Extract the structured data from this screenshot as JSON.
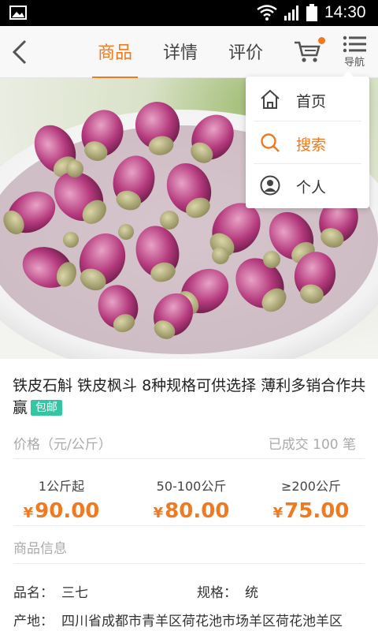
{
  "status_bar": {
    "time": "14:30"
  },
  "header": {
    "tabs": [
      {
        "label": "商品",
        "active": true
      },
      {
        "label": "详情",
        "active": false
      },
      {
        "label": "评价",
        "active": false
      }
    ],
    "nav_label": "导航"
  },
  "dropdown": {
    "items": [
      {
        "label": "首页",
        "icon": "home-icon",
        "active": false
      },
      {
        "label": "搜索",
        "icon": "search-icon",
        "active": true
      },
      {
        "label": "个人",
        "icon": "user-icon",
        "active": false
      }
    ]
  },
  "product": {
    "title": "铁皮石斛 铁皮枫斗 8种规格可供选择 薄利多销合作共赢",
    "badge": "包邮",
    "price_label": "价格（元/公斤）",
    "sold": "已成交 100 笔",
    "currency": "¥",
    "tiers": [
      {
        "range": "1公斤起",
        "price": "90.00"
      },
      {
        "range": "50-100公斤",
        "price": "80.00"
      },
      {
        "range": "≥200公斤",
        "price": "75.00"
      }
    ],
    "info_heading": "商品信息",
    "name_key": "品名：",
    "name_value": "三七",
    "spec_key": "规格：",
    "spec_value": "统",
    "origin_key": "产地：",
    "origin_value": "四川省成都市青羊区荷花池市场羊区荷花池羊区"
  },
  "colors": {
    "accent": "#f07a1f",
    "badge": "#32c7a0"
  }
}
